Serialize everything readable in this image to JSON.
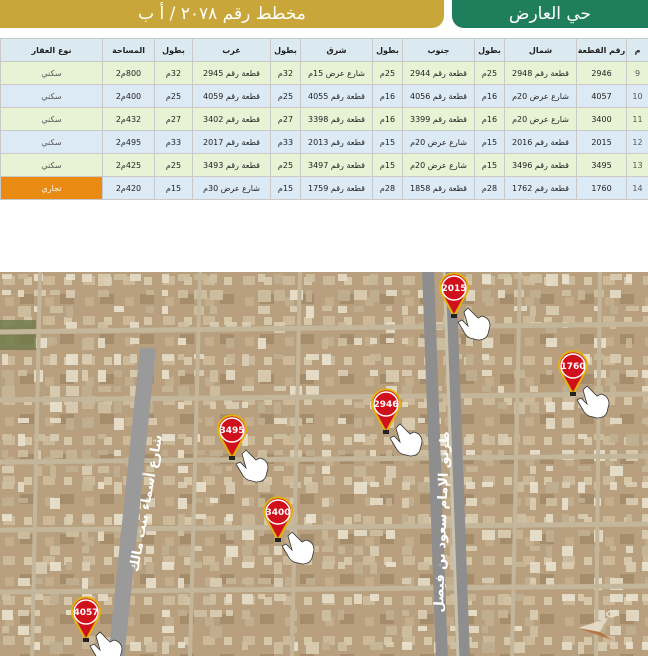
{
  "header": {
    "plan_title": "مخطط رقم ٢٠٧٨ / أ ب",
    "district": "حي العارض"
  },
  "table": {
    "columns": [
      "م",
      "رقم القطعة",
      "شمال",
      "بطول",
      "جنوب",
      "بطول",
      "شرق",
      "بطول",
      "غرب",
      "بطول",
      "المساحة",
      "نوع العقار"
    ],
    "rows": [
      {
        "no": "9",
        "plot": "2946",
        "north": "قطعة رقم 2948",
        "north_len": "25م",
        "south": "قطعة رقم 2944",
        "south_len": "25م",
        "east": "شارع عرض 15م",
        "east_len": "32م",
        "west": "قطعة رقم 2945",
        "west_len": "32م",
        "area": "800م2",
        "type": "سكني"
      },
      {
        "no": "10",
        "plot": "4057",
        "north": "شارع عرض 20م",
        "north_len": "16م",
        "south": "قطعة رقم 4056",
        "south_len": "16م",
        "east": "قطعة رقم 4055",
        "east_len": "25م",
        "west": "قطعة رقم 4059",
        "west_len": "25م",
        "area": "400م2",
        "type": "سكني"
      },
      {
        "no": "11",
        "plot": "3400",
        "north": "شارع عرض 20م",
        "north_len": "16م",
        "south": "قطعة رقم 3399",
        "south_len": "16م",
        "east": "قطعة رقم 3398",
        "east_len": "27م",
        "west": "قطعة رقم 3402",
        "west_len": "27م",
        "area": "432م2",
        "type": "سكني"
      },
      {
        "no": "12",
        "plot": "2015",
        "north": "قطعة رقم 2016",
        "north_len": "15م",
        "south": "شارع عرض 20م",
        "south_len": "15م",
        "east": "قطعة رقم 2013",
        "east_len": "33م",
        "west": "قطعة رقم 2017",
        "west_len": "33م",
        "area": "495م2",
        "type": "سكني"
      },
      {
        "no": "13",
        "plot": "3495",
        "north": "قطعة رقم 3496",
        "north_len": "15م",
        "south": "شارع عرض 20م",
        "south_len": "15م",
        "east": "قطعة رقم 3497",
        "east_len": "25م",
        "west": "قطعة رقم 3493",
        "west_len": "25م",
        "area": "425م2",
        "type": "سكني"
      },
      {
        "no": "14",
        "plot": "1760",
        "north": "قطعة رقم 1762",
        "north_len": "28م",
        "south": "قطعة رقم 1858",
        "south_len": "28م",
        "east": "قطعة رقم 1759",
        "east_len": "15م",
        "west": "شارع عرض 30م",
        "west_len": "15م",
        "area": "420م2",
        "type": "تجاري"
      }
    ]
  },
  "map": {
    "streets": [
      {
        "name": "شارع أسماء بنت مالك"
      },
      {
        "name": "طريق الإمام سعود بن فيصل"
      }
    ],
    "pins": [
      {
        "label": "2015"
      },
      {
        "label": "1760"
      },
      {
        "label": "2946"
      },
      {
        "label": "3495"
      },
      {
        "label": "3400"
      },
      {
        "label": "4057"
      }
    ],
    "pin_color": "#d0101a",
    "pin_border": "#e0b20a",
    "hand_icon": "pointing-hand-icon",
    "compass_icon": "north-arrow-icon"
  },
  "colors": {
    "header_gold": "#c9a639",
    "header_green": "#1f7f5c",
    "row_green": "#e8f3d6",
    "row_blue": "#dceaf6",
    "commercial": "#e98a12"
  }
}
